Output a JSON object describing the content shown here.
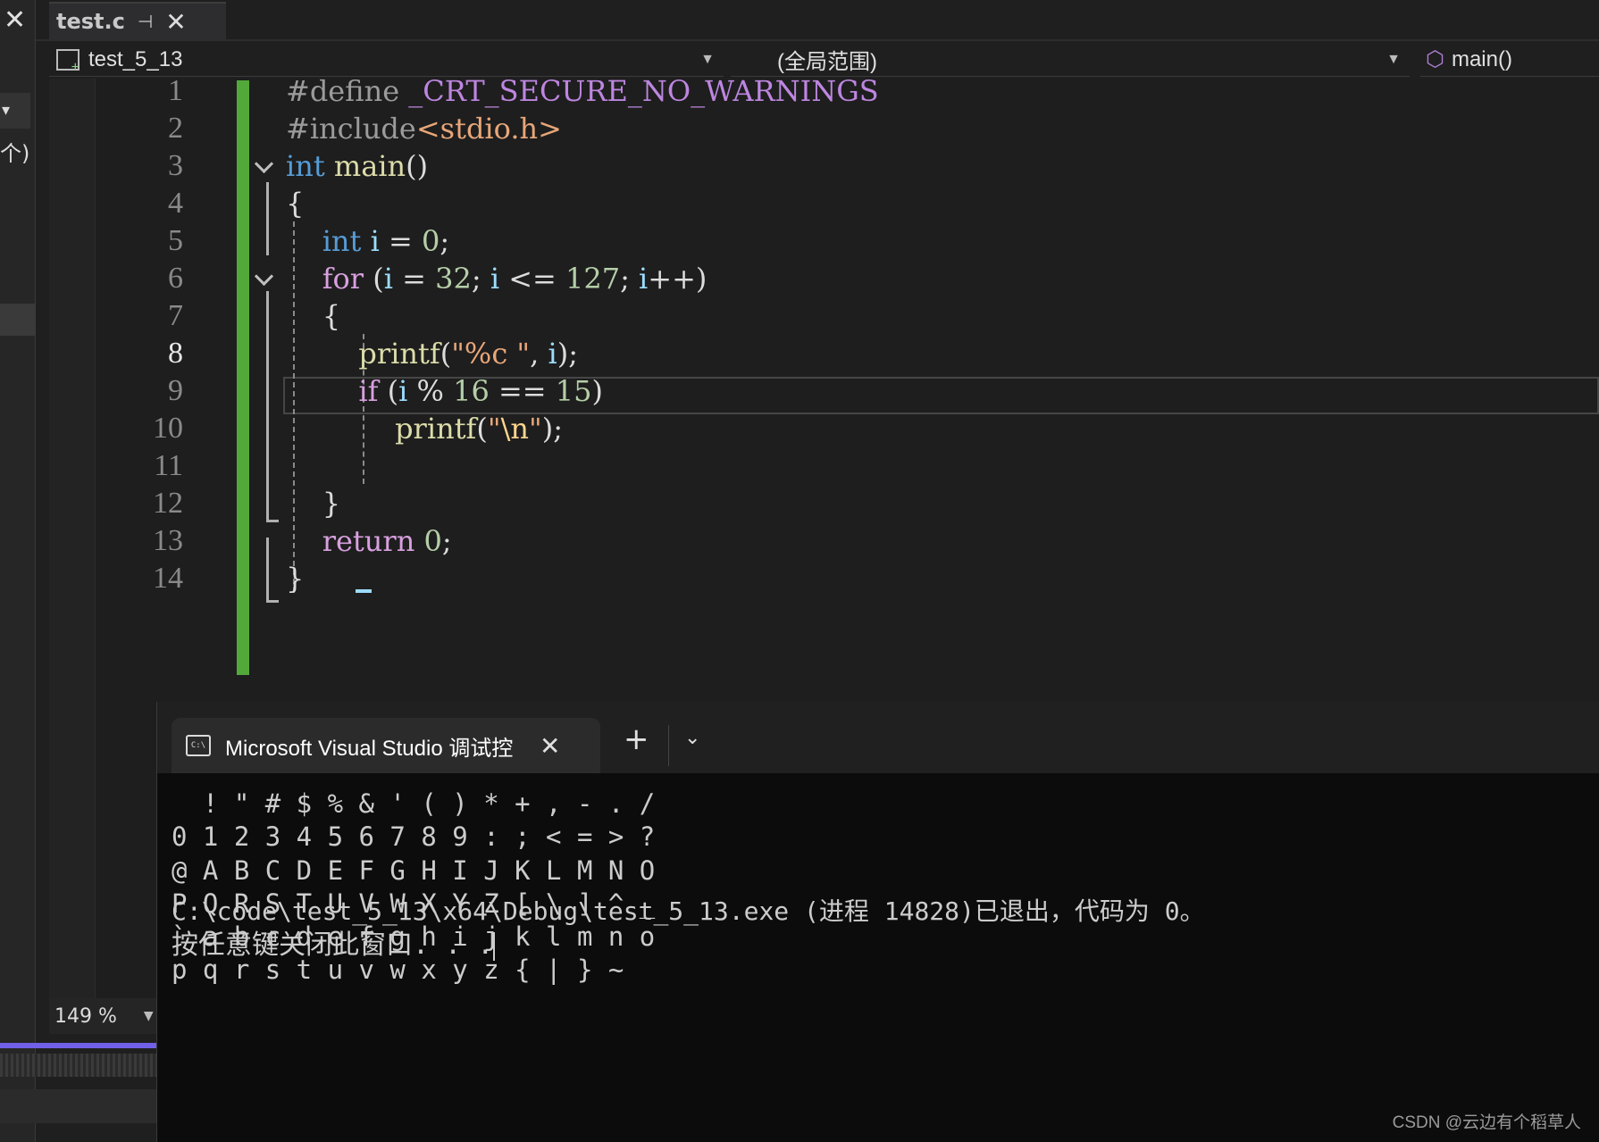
{
  "left_panel": {
    "dropdown_glyph": "▾",
    "count_text": "个)"
  },
  "tab": {
    "file_name": "test.c",
    "pin_glyph": "⊣",
    "close_glyph": "✕"
  },
  "nav": {
    "project": "test_5_13",
    "scope": "(全局范围)",
    "function": "main()"
  },
  "editor": {
    "zoom": "149 %",
    "line_numbers": [
      "1",
      "2",
      "3",
      "4",
      "5",
      "6",
      "7",
      "8",
      "9",
      "10",
      "11",
      "12",
      "13",
      "14"
    ],
    "current_line": 8
  },
  "terminal": {
    "tab_title": "Microsoft Visual Studio 调试控",
    "output_lines": [
      "  ! \" # $ % & ' ( ) * + , - . /",
      "0 1 2 3 4 5 6 7 8 9 : ; < = > ?",
      "@ A B C D E F G H I J K L M N O",
      "P Q R S T U V W X Y Z [ \\ ] ^ _",
      "` a b c d e f g h i j k l m n o",
      "p q r s t u v w x y z { | } ~"
    ],
    "exit_message": "C:\\code\\test_5_13\\x64\\Debug\\test_5_13.exe (进程 14828)已退出，代码为 0。",
    "press_key_message": "按任意键关闭此窗口. . ."
  },
  "watermark": "CSDN @云边有个稻草人",
  "colors": {
    "keyword": "#569cd6",
    "control_keyword": "#d8a0df",
    "function": "#dcdcaa",
    "string": "#e8a679",
    "number": "#b5cea8",
    "variable": "#9cdcfe",
    "change_bar": "#53a83a"
  }
}
